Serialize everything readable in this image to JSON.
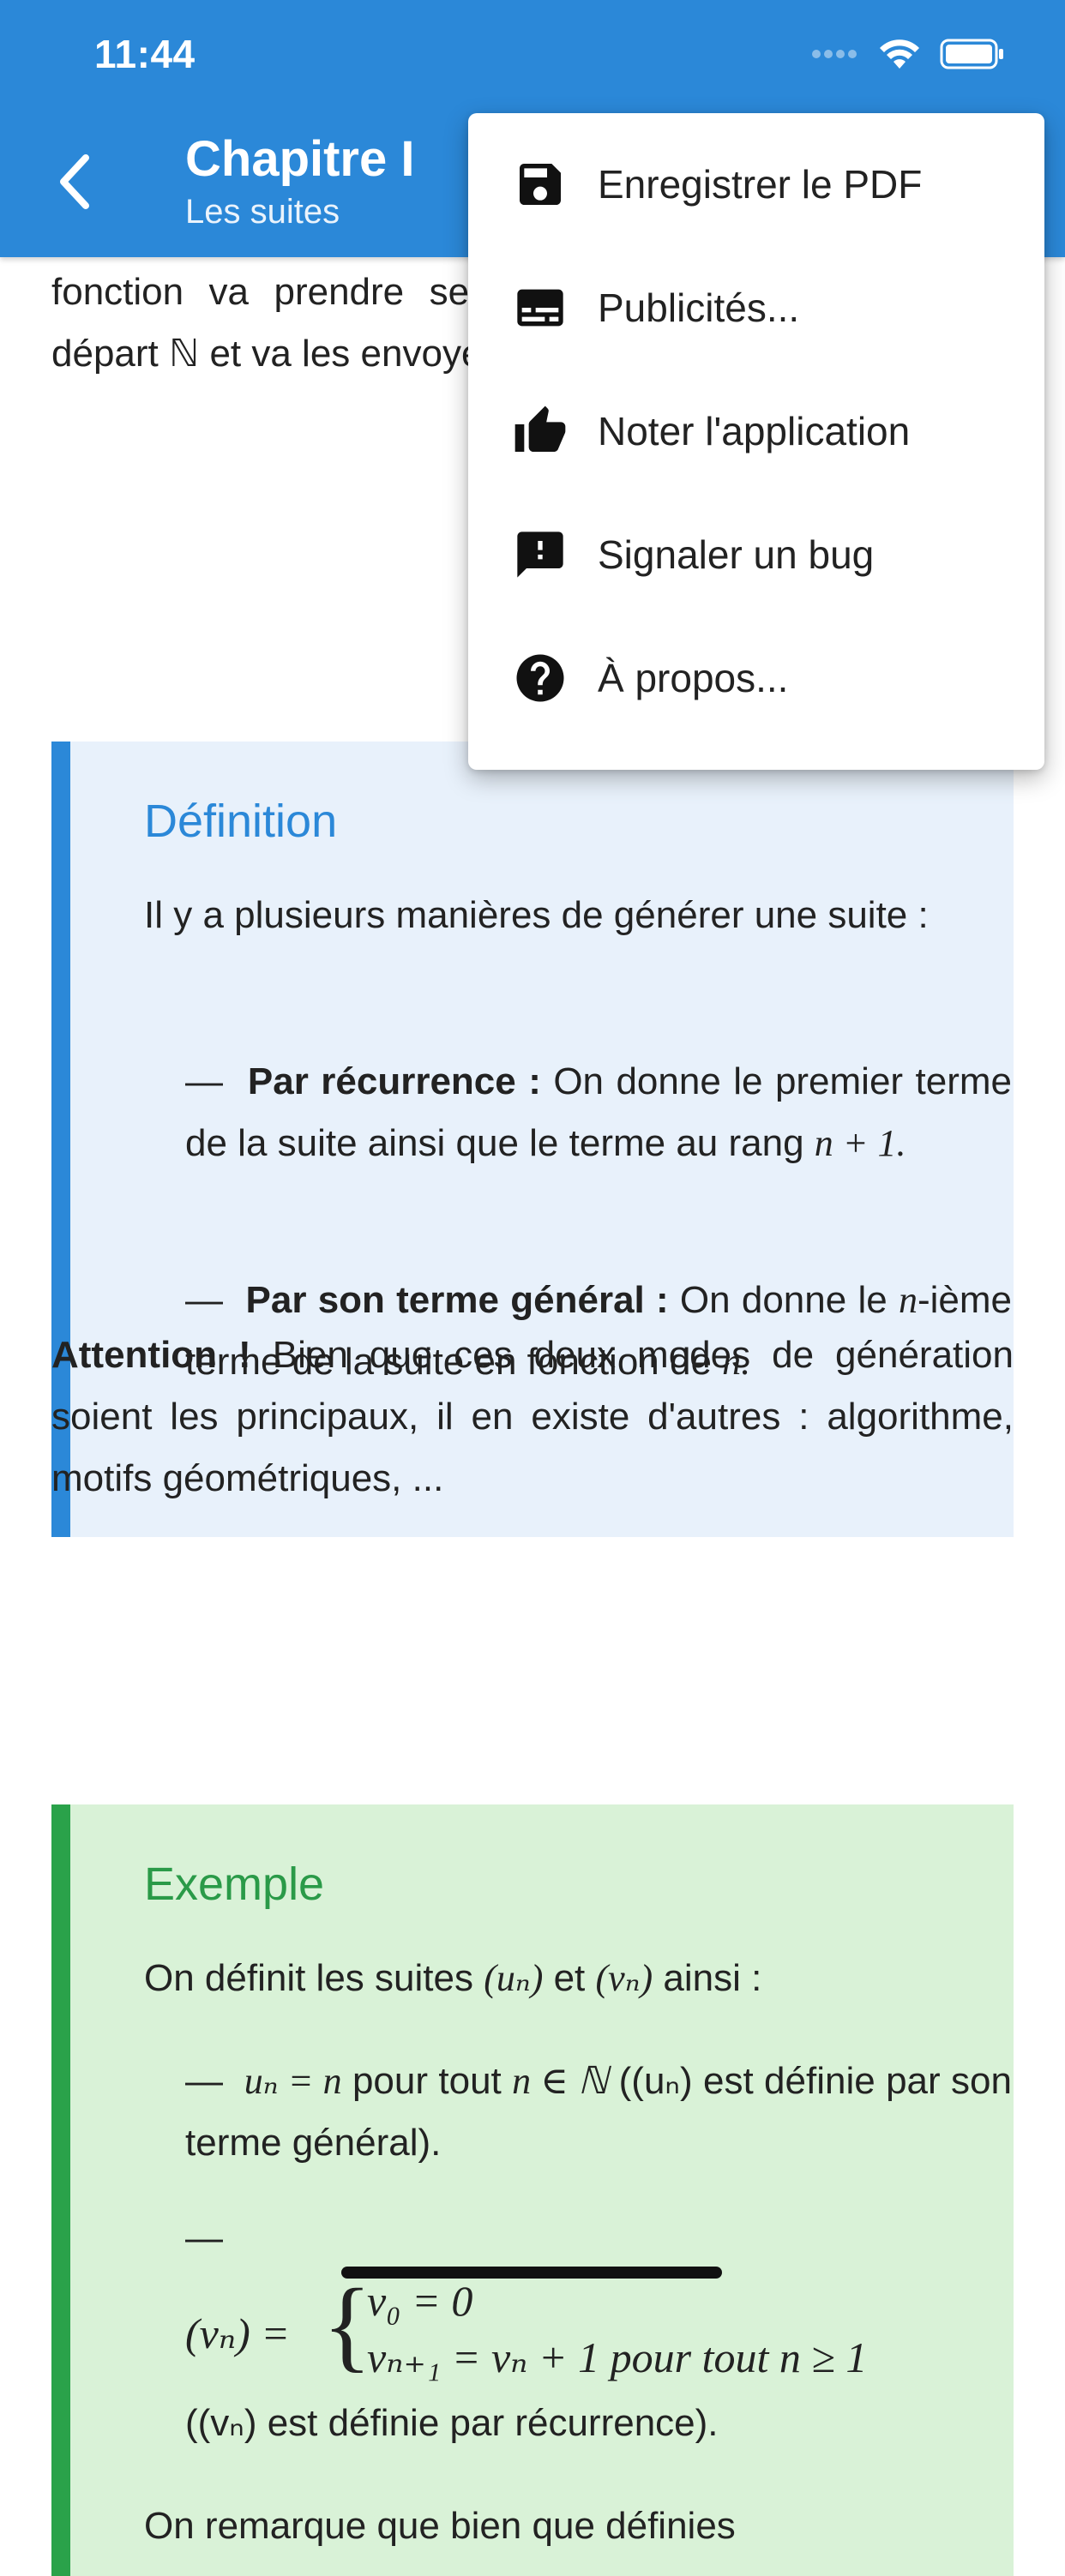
{
  "status_bar": {
    "time": "11:44"
  },
  "header": {
    "title": "Chapitre I",
    "subtitle": "Les suites"
  },
  "content": {
    "para_top": "fonction va prendre ses valeurs dans l'ensemble de départ ℕ et va les envoyer dans l'ensemble d'arrivée ℝ.",
    "definition": {
      "title": "Définition",
      "intro": "Il y a plusieurs manières de générer une suite :",
      "item1_bold": "Par récurrence :",
      "item1_text": "On donne le premier terme de la suite ainsi que le terme au rang",
      "item1_math": "n + 1.",
      "item2_bold": "Par son terme général :",
      "item2_text": "On donne le",
      "item2_math": "n",
      "item2_text2": "-ième terme de la suite en fonction de",
      "item2_math2": "n."
    },
    "attention_bold": "Attention !",
    "attention_text": "Bien que ces deux modes de génération soient les principaux, il en existe d'autres : algorithme, motifs géométriques, ...",
    "example": {
      "title": "Exemple",
      "intro_a": "On définit les suites",
      "intro_u": "(uₙ)",
      "intro_b": "et",
      "intro_v": "(vₙ)",
      "intro_c": "ainsi :",
      "item1_math": "uₙ = n",
      "item1_a": "pour tout",
      "item1_math2": "n ∈ ℕ",
      "item1_b": "((uₙ) est définie par son terme général).",
      "item2_lhs": "(vₙ) =",
      "item2_line1": "v₀ = 0",
      "item2_line2": "vₙ₊₁ = vₙ + 1 pour tout n ≥ 1",
      "item2_tail": "((vₙ) est définie par récurrence).",
      "bottom": "On remarque que bien que définies"
    }
  },
  "menu": {
    "items": [
      {
        "label": "Enregistrer le PDF",
        "icon": "save-icon"
      },
      {
        "label": "Publicités...",
        "icon": "subtitles-icon"
      },
      {
        "label": "Noter l'application",
        "icon": "thumb-up-icon"
      },
      {
        "label": "Signaler un bug",
        "icon": "feedback-icon"
      },
      {
        "label": "À propos...",
        "icon": "help-icon"
      }
    ]
  },
  "colors": {
    "header": "#2b88d8",
    "definition_bar": "#2b88d8",
    "definition_bg": "#e8f1fb",
    "example_bar": "#2aa24a",
    "example_bg": "#d9f2d7"
  }
}
